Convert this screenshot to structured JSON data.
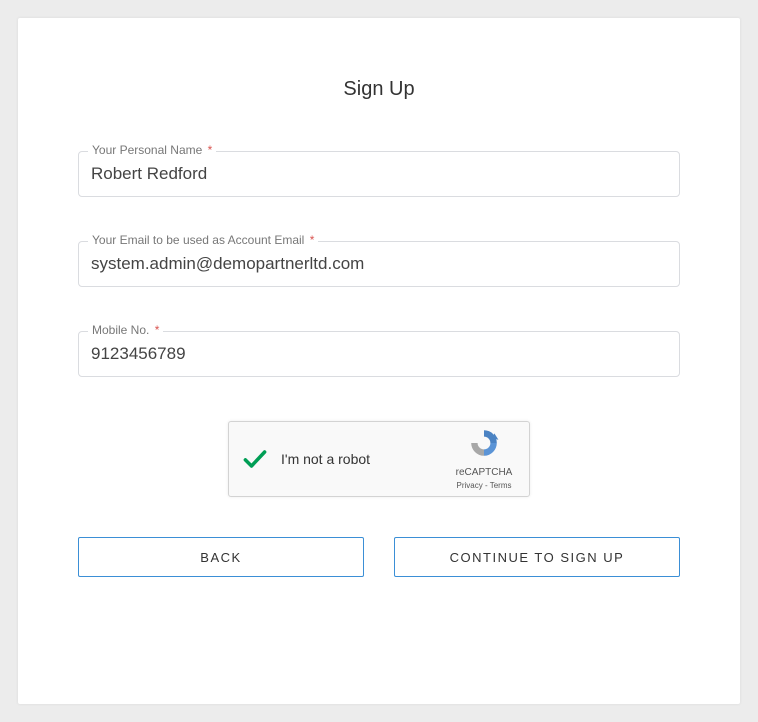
{
  "title": "Sign Up",
  "fields": {
    "name": {
      "label": "Your Personal Name",
      "required": "*",
      "value": "Robert Redford"
    },
    "email": {
      "label": "Your Email to be used as Account Email",
      "required": "*",
      "value": "system.admin@demopartnerltd.com"
    },
    "mobile": {
      "label": "Mobile No.",
      "required": "*",
      "value": "9123456789"
    }
  },
  "captcha": {
    "text": "I'm not a robot",
    "brand": "reCAPTCHA",
    "privacy": "Privacy",
    "dash": " - ",
    "terms": "Terms"
  },
  "buttons": {
    "back": "BACK",
    "continue": "CONTINUE TO SIGN UP"
  }
}
